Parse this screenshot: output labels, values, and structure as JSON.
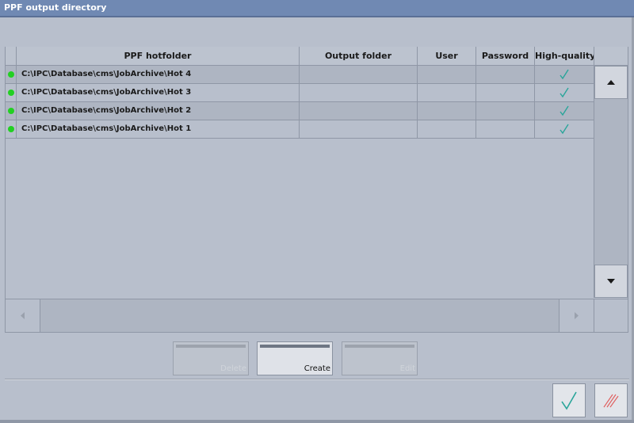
{
  "window": {
    "title": "PPF output directory"
  },
  "table": {
    "columns": [
      "PPF hotfolder",
      "Output folder",
      "User",
      "Password",
      "High-quality ..."
    ],
    "rows": [
      {
        "hotfolder": "C:\\IPC\\Database\\cms\\JobArchive\\Hot 4",
        "output": "",
        "user": "",
        "password": "",
        "high_quality": true,
        "status": "active"
      },
      {
        "hotfolder": "C:\\IPC\\Database\\cms\\JobArchive\\Hot 3",
        "output": "",
        "user": "",
        "password": "",
        "high_quality": true,
        "status": "active"
      },
      {
        "hotfolder": "C:\\IPC\\Database\\cms\\JobArchive\\Hot 2",
        "output": "",
        "user": "",
        "password": "",
        "high_quality": true,
        "status": "active"
      },
      {
        "hotfolder": "C:\\IPC\\Database\\cms\\JobArchive\\Hot 1",
        "output": "",
        "user": "",
        "password": "",
        "high_quality": true,
        "status": "active"
      }
    ]
  },
  "buttons": {
    "delete": "Delete",
    "create": "Create",
    "edit": "Edit"
  },
  "colors": {
    "status_ok": "#22d022",
    "check": "#2aa59a",
    "cancel": "#e06060",
    "title_bar": "#7089b3"
  },
  "icons": {
    "ok": "checkmark-icon",
    "cancel": "cancel-icon",
    "up": "arrow-up-icon",
    "down": "arrow-down-icon",
    "left": "arrow-left-icon",
    "right": "arrow-right-icon"
  }
}
